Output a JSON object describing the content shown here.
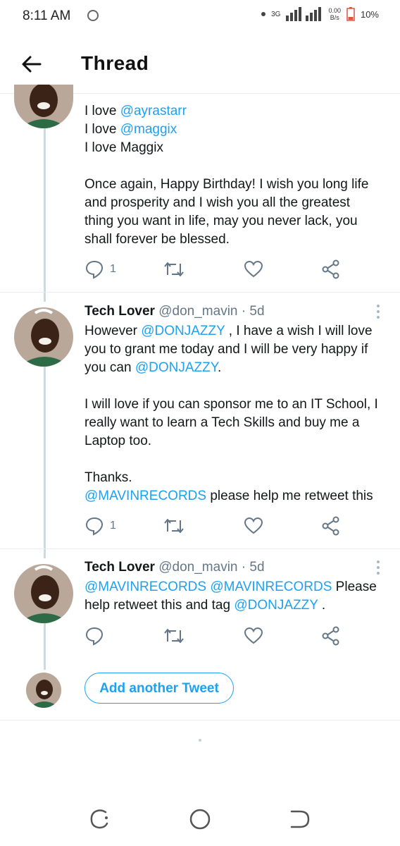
{
  "status": {
    "time": "8:11 AM",
    "network": "3G",
    "speed": "0.00",
    "speed_unit": "B/s",
    "battery": "10%"
  },
  "header": {
    "title": "Thread"
  },
  "tweet1": {
    "lines": [
      "I love @ayrastarr",
      "I love @maggix",
      "I love Maggix"
    ],
    "line1_pre": "I love ",
    "line1_mention": "@ayrastarr",
    "line2_pre": "I love ",
    "line2_mention": "@maggix",
    "line3": "I love Maggix",
    "para": "Once again, Happy Birthday! I wish you long life and prosperity and I wish you all the greatest thing you want in life, may you never lack, you shall forever be blessed.",
    "reply_count": "1"
  },
  "tweet2": {
    "name": "Tech Lover",
    "handle": "@don_mavin",
    "time": "· 5d",
    "p1_pre": "However ",
    "p1_mention": "@DONJAZZY",
    "p1_mid": " , I have a wish I will love you to grant me today and I will be very happy if you can ",
    "p1_mention2": "@DONJAZZY",
    "p1_post": ".",
    "p2": "I will love if you can sponsor me to an IT School, I really want to learn a Tech Skills and buy me a Laptop too.",
    "p3": "Thanks.",
    "p4_mention": "@MAVINRECORDS",
    "p4_post": " please help me retweet this",
    "reply_count": "1"
  },
  "tweet3": {
    "name": "Tech Lover",
    "handle": "@don_mavin",
    "time": "· 5d",
    "mention1": "@MAVINRECORDS",
    "mention2": "@MAVINRECORDS",
    "mid": " Please help retweet this and tag ",
    "mention3": "@DONJAZZY",
    "post": " ."
  },
  "add_button": "Add another Tweet",
  "colors": {
    "accent": "#1da1f2",
    "text": "#14171a",
    "muted": "#657786",
    "line": "#cfd9de"
  },
  "icons": [
    "reply-icon",
    "retweet-icon",
    "like-icon",
    "share-icon",
    "more-icon",
    "back-arrow-icon"
  ]
}
